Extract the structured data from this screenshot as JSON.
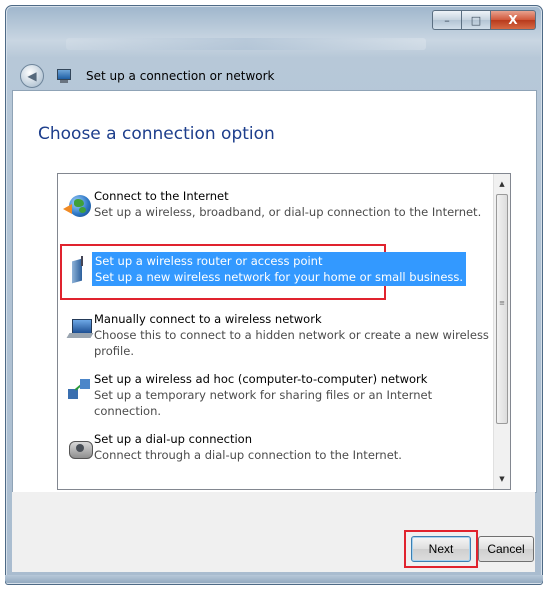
{
  "window": {
    "title": "Set up a connection or network",
    "controls": {
      "minimize": "–",
      "maximize": "□",
      "close": "X"
    }
  },
  "heading": "Choose a connection option",
  "options": [
    {
      "title": "Connect to the Internet",
      "description": "Set up a wireless, broadband, or dial-up connection to the Internet.",
      "icon": "globe-icon",
      "selected": false
    },
    {
      "title": "Set up a wireless router or access point",
      "description": "Set up a new wireless network for your home or small business.",
      "icon": "wireless-router-icon",
      "selected": true
    },
    {
      "title": "Manually connect to a wireless network",
      "description": "Choose this to connect to a hidden network or create a new wireless profile.",
      "icon": "wireless-laptop-icon",
      "selected": false
    },
    {
      "title": "Set up a wireless ad hoc (computer-to-computer) network",
      "description": "Set up a temporary network for sharing files or an Internet connection.",
      "icon": "adhoc-network-icon",
      "selected": false
    },
    {
      "title": "Set up a dial-up connection",
      "description": "Connect through a dial-up connection to the Internet.",
      "icon": "dialup-phone-icon",
      "selected": false
    }
  ],
  "buttons": {
    "next": "Next",
    "cancel": "Cancel"
  },
  "highlight_color": "#e0232e",
  "selection_color": "#3399ff",
  "heading_color": "#1d3e8c"
}
